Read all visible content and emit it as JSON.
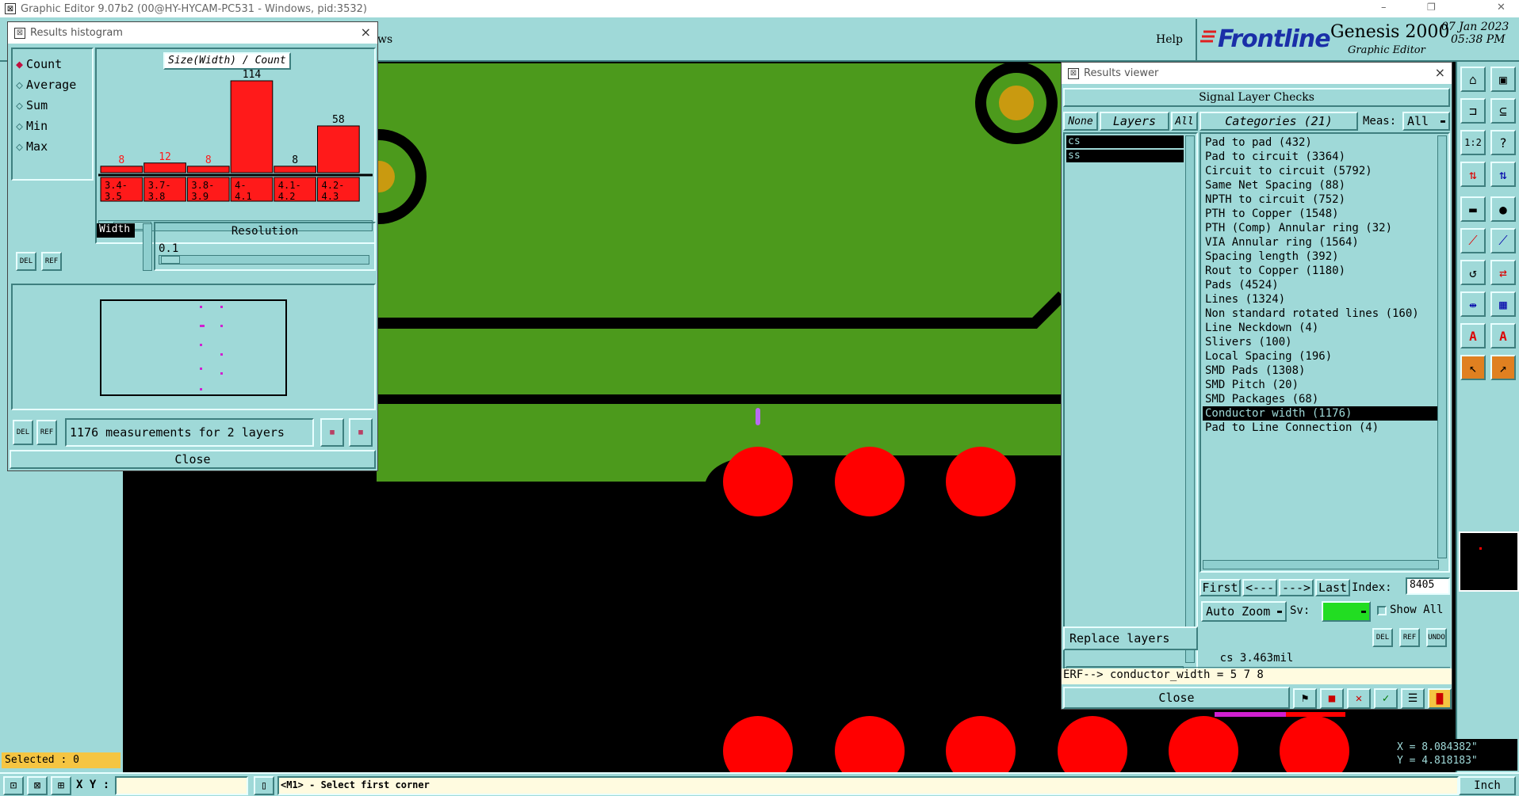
{
  "app": {
    "title": "Graphic Editor 9.07b2 (00@HY-HYCAM-PC531 - Windows, pid:3532)",
    "minimize": "–",
    "restore": "❐",
    "close": "✕"
  },
  "header": {
    "menu_partial": "ws",
    "help": "Help",
    "brand": "Frontline",
    "product": "Genesis 2000",
    "product_sub": "Graphic Editor",
    "date": "07 Jan 2023",
    "time": "05:38 PM"
  },
  "histogram": {
    "title": "Results histogram",
    "modes": [
      "Count",
      "Average",
      "Sum",
      "Min",
      "Max"
    ],
    "selected_mode": "Count",
    "chart_title": "Size(Width) / Count",
    "width_label": "Width",
    "resolution_label": "Resolution",
    "resolution_value": "0.1",
    "summary": "1176 measurements for 2 layers",
    "close": "Close",
    "del": "DEL",
    "ref": "REF"
  },
  "chart_data": {
    "type": "bar",
    "title": "Size(Width) / Count",
    "categories": [
      "3.4-3.5",
      "3.7-3.8",
      "3.8-3.9",
      "4-4.1",
      "4.1-4.2",
      "4.2-4.3"
    ],
    "values": [
      8,
      12,
      8,
      114,
      8,
      58
    ],
    "bar_color": "#ff1a1a",
    "label_color_small": "#ff1a1a"
  },
  "results_viewer": {
    "title": "Results viewer",
    "heading": "Signal Layer Checks",
    "none": "None",
    "layers": "Layers",
    "all": "All",
    "layer_items": [
      "cs",
      "ss"
    ],
    "categories_label": "Categories (21)",
    "meas_label": "Meas:",
    "meas_value": "All",
    "categories": [
      "Pad to pad (432)",
      "Pad to circuit (3364)",
      "Circuit to circuit (5792)",
      "Same Net Spacing (88)",
      "NPTH to circuit (752)",
      "PTH to Copper (1548)",
      "PTH (Comp) Annular ring (32)",
      "VIA Annular ring (1564)",
      "Spacing length (392)",
      "Rout to Copper (1180)",
      "Pads (4524)",
      "Lines (1324)",
      "Non standard rotated lines (160)",
      "Line Neckdown (4)",
      "Slivers (100)",
      "Local Spacing (196)",
      "SMD Pads (1308)",
      "SMD Pitch (20)",
      "SMD Packages (68)",
      "Conductor width (1176)",
      "Pad to Line Connection (4)"
    ],
    "selected_category": "Conductor width (1176)",
    "first": "First",
    "prev": "<---",
    "next": "--->",
    "last": "Last",
    "index_label": "Index:",
    "index_value": "8405",
    "auto_zoom": "Auto Zoom",
    "sv_label": "Sv:",
    "show_all": "Show All",
    "replace_layers": "Replace layers",
    "measure_text": "cs 3.463mil",
    "erf_text": "ERF--> conductor_width = 5 7 8",
    "close": "Close",
    "del": "DEL",
    "ref": "REF",
    "undo": "UNDO"
  },
  "status": {
    "selected": "Selected : 0",
    "xy_label": "X Y :",
    "prompt": "<M1> - Select first corner",
    "x_coord": "X = 8.084382\"",
    "y_coord": "Y = 4.818183\"",
    "units": "Inch"
  },
  "colors": {
    "teal": "#9fd9d8",
    "green_copper": "#4c9a1c",
    "pad_red": "#ff0000",
    "highlight_black": "#000000"
  }
}
